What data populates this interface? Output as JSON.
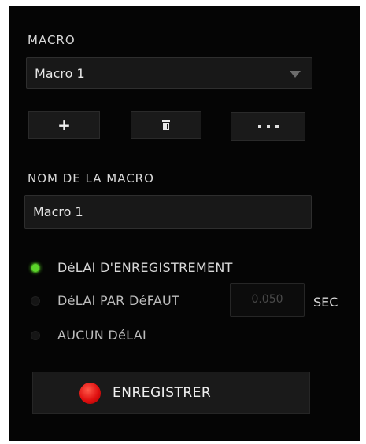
{
  "macro_section": {
    "title": "MACRO",
    "selected_macro": "Macro 1",
    "buttons": {
      "add_label": "+",
      "delete_icon": "trash-icon",
      "more_icon": "more-dots-icon"
    }
  },
  "name_section": {
    "title": "NOM DE LA MACRO",
    "value": "Macro 1"
  },
  "delay_options": {
    "record_delay_label": "DéLAI D'ENREGISTREMENT",
    "default_delay_label": "DéLAI PAR DéFAUT",
    "default_delay_value": "0.050",
    "default_delay_unit": "SEC",
    "no_delay_label": "AUCUN DéLAI",
    "selected": "record_delay"
  },
  "record_button": {
    "label": "ENREGISTRER"
  },
  "colors": {
    "background": "#050505",
    "accent_green": "#5cd42a",
    "record_red": "#e01010"
  }
}
